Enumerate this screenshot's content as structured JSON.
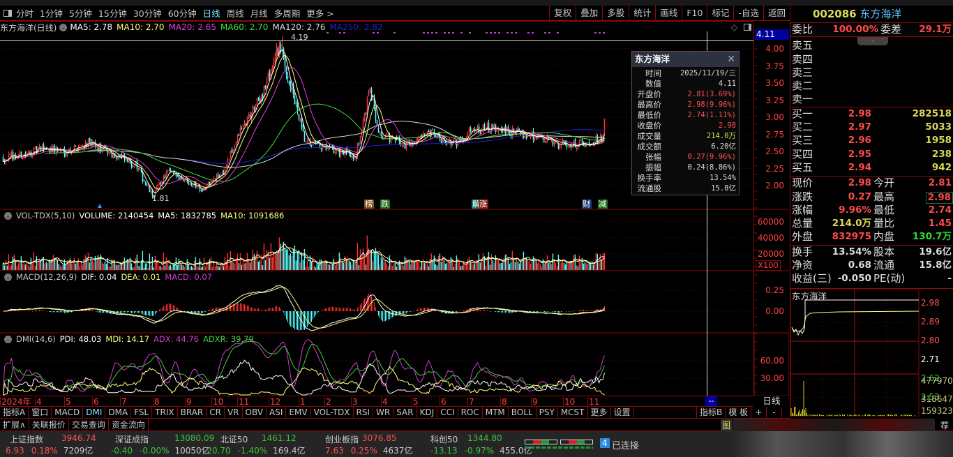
{
  "toolbar": {
    "periods": [
      "分时",
      "1分钟",
      "5分钟",
      "15分钟",
      "30分钟",
      "60分钟",
      "日线",
      "周线",
      "月线",
      "多周期",
      "更多 >"
    ],
    "active_period": "日线",
    "right": [
      "复权",
      "叠加",
      "多股",
      "统计",
      "画线",
      "F10",
      "标记",
      "-自选",
      "返回"
    ]
  },
  "title_row": {
    "name": "东方海洋(日线)",
    "mas": [
      {
        "label": "MA5: 2.78",
        "color": "#ffffff"
      },
      {
        "label": "MA10: 2.70",
        "color": "#ffff80"
      },
      {
        "label": "MA20: 2.65",
        "color": "#e040e0"
      },
      {
        "label": "MA60: 2.70",
        "color": "#40e040"
      },
      {
        "label": "MA120: 2.76",
        "color": "#dddddd"
      },
      {
        "label": "MA250: 2.82",
        "color": "#2020d0"
      }
    ]
  },
  "main": {
    "price_axis": [
      "4.00",
      "3.75",
      "3.50",
      "3.25",
      "3.00",
      "2.75",
      "2.50",
      "2.25",
      "2.00"
    ],
    "cursor_value": "4.11",
    "high_label": "4.19",
    "low_label": "1.81",
    "events": [
      {
        "t": "榜",
        "bg": "#7a4a20"
      },
      {
        "t": "跌",
        "bg": "#1f6a1f"
      },
      {
        "t": "解",
        "bg": "#1a7a7a"
      },
      {
        "t": "涨",
        "bg": "#8a1a1a"
      },
      {
        "t": "财",
        "bg": "#1a3a7a"
      },
      {
        "t": "减",
        "bg": "#1f6a1f"
      }
    ]
  },
  "tooltip": {
    "title": "东方海洋",
    "rows": [
      {
        "k": "时间",
        "v": "2025/11/19/三",
        "c": "#dddddd"
      },
      {
        "k": "数值",
        "v": "4.11",
        "c": "#dddddd"
      },
      {
        "k": "开盘价",
        "v": "2.81(3.69%)",
        "c": "#ff5050"
      },
      {
        "k": "最高价",
        "v": "2.98(9.96%)",
        "c": "#ff5050"
      },
      {
        "k": "最低价",
        "v": "2.74(1.11%)",
        "c": "#ff5050"
      },
      {
        "k": "收盘价",
        "v": "2.98",
        "c": "#ff5050"
      },
      {
        "k": "成交量",
        "v": "214.0万",
        "c": "#dada5a"
      },
      {
        "k": "成交额",
        "v": "6.20亿",
        "c": "#dddddd"
      },
      {
        "k": "张幅",
        "v": "0.27(9.96%)",
        "c": "#ff5050"
      },
      {
        "k": "振幅",
        "v": "0.24(8.86%)",
        "c": "#dddddd"
      },
      {
        "k": "换手率",
        "v": "13.54%",
        "c": "#dddddd"
      },
      {
        "k": "流通股",
        "v": "15.8亿",
        "c": "#dddddd"
      }
    ]
  },
  "vol": {
    "name": "VOL-TDX(5,10)",
    "volume": "VOLUME: 2140454",
    "ma5": "MA5: 1832785",
    "ma10": "MA10: 1091686",
    "axis": [
      "60000",
      "40000",
      "20000"
    ],
    "unit": "X100"
  },
  "macd": {
    "name": "MACD(12,26,9)",
    "dif": "DIF: 0.04",
    "dea": "DEA: 0.01",
    "macd": "MACD: 0.07",
    "axis": [
      "0.25",
      "0.00"
    ]
  },
  "dmi": {
    "name": "DMI(14,6)",
    "pdi": "PDI: 48.03",
    "mdi": "MDI: 14.17",
    "adx": "ADX: 44.76",
    "adxr": "ADXR: 39.79",
    "axis": [
      "60.00",
      "30.00"
    ]
  },
  "date_axis": {
    "labels": [
      "2024年",
      "4",
      "5",
      "6",
      "7",
      "8",
      "9",
      "10",
      "11",
      "12",
      "1",
      "2",
      "3",
      "4",
      "5",
      "6",
      "7",
      "8",
      "9",
      "10",
      "11"
    ],
    "cursor": "--",
    "period": "日线"
  },
  "indicator_tabs": [
    "指标A",
    "窗口",
    "MACD",
    "DMI",
    "DMA",
    "FSL",
    "TRIX",
    "BRAR",
    "CR",
    "VR",
    "OBV",
    "ASI",
    "EMV",
    "VOL-TDX",
    "RSI",
    "WR",
    "SAR",
    "KDJ",
    "CCI",
    "ROC",
    "MTM",
    "BOLL",
    "PSY",
    "MCST",
    "更多",
    "设置"
  ],
  "active_tab": "DMI",
  "right_tabs": [
    "指标B",
    "模 板",
    "+",
    "-"
  ],
  "ext_tabs": [
    "扩展∧",
    "关联报价",
    "交易查询",
    "资金流向"
  ],
  "ext_right": [
    "图",
    "荐"
  ],
  "quote": {
    "code": "002086",
    "name": "东方海洋",
    "weibi": {
      "l": "委比",
      "v": "100.00%",
      "l2": "委差",
      "v2": "29.1万"
    },
    "sell": [
      "卖五",
      "卖四",
      "卖三",
      "卖二",
      "卖一"
    ],
    "buy": [
      {
        "l": "买一",
        "p": "2.98",
        "v": "282518"
      },
      {
        "l": "买二",
        "p": "2.97",
        "v": "5033"
      },
      {
        "l": "买三",
        "p": "2.96",
        "v": "1958"
      },
      {
        "l": "买四",
        "p": "2.95",
        "v": "238"
      },
      {
        "l": "买五",
        "p": "2.94",
        "v": "942"
      }
    ],
    "stats": [
      {
        "l": "现价",
        "v": "2.98",
        "vc": "red",
        "l2": "今开",
        "v2": "2.81",
        "v2c": "red"
      },
      {
        "l": "涨跌",
        "v": "0.27",
        "vc": "red",
        "l2": "最高",
        "v2": "2.98",
        "v2c": "red"
      },
      {
        "l": "涨幅",
        "v": "9.96%",
        "vc": "red",
        "l2": "最低",
        "v2": "2.74",
        "v2c": "red"
      },
      {
        "l": "总量",
        "v": "214.0万",
        "vc": "yel",
        "l2": "量比",
        "v2": "1.45",
        "v2c": "red"
      },
      {
        "l": "外盘",
        "v": "832975",
        "vc": "red",
        "l2": "内盘",
        "v2": "130.7万",
        "v2c": "grn"
      }
    ],
    "fund": [
      {
        "l": "换手",
        "v": "13.54%",
        "l2": "股本",
        "v2": "19.6亿"
      },
      {
        "l": "净资",
        "v": "0.68",
        "l2": "流通",
        "v2": "15.8亿"
      },
      {
        "l": "收益(三)",
        "v": "-0.050",
        "l2": "PE(动)",
        "v2": "-"
      }
    ]
  },
  "mini": {
    "title": "东方海洋",
    "price_axis": [
      {
        "v": "2.98",
        "c": "#ff5050"
      },
      {
        "v": "2.89",
        "c": "#ff5050"
      },
      {
        "v": "2.80",
        "c": "#ff5050"
      },
      {
        "v": "2.71",
        "c": "#ffffff"
      },
      {
        "v": "2.62",
        "c": "#40c040"
      },
      {
        "v": "2.53",
        "c": "#40c040"
      }
    ],
    "vol_axis": [
      "477970",
      "318647",
      "159323"
    ]
  },
  "status": {
    "indices": [
      {
        "name": "上证指数",
        "value": "3946.74",
        "chg": "6.93",
        "pct": "0.18%",
        "amt": "7209亿",
        "c": "#ff5050"
      },
      {
        "name": "深证成指",
        "value": "13080.09",
        "chg": "-0.40",
        "pct": "-0.00%",
        "amt": "10050亿",
        "c": "#40c040"
      },
      {
        "name": "北证50",
        "value": "1461.12",
        "chg": "-20.70",
        "pct": "-1.40%",
        "amt": "169.4亿",
        "c": "#40c040"
      },
      {
        "name": "创业板指",
        "value": "3076.85",
        "chg": "7.63",
        "pct": "0.25%",
        "amt": "4637亿",
        "c": "#ff5050"
      },
      {
        "name": "科创50",
        "value": "1344.80",
        "chg": "-13.13",
        "pct": "-0.97%",
        "amt": "455.0亿",
        "c": "#40c040"
      }
    ],
    "conn_num": "4",
    "conn": "已连接"
  },
  "chart_data": {
    "type": "candlestick",
    "days": 432,
    "close_anchors": [
      [
        0,
        2.4
      ],
      [
        15,
        2.45
      ],
      [
        30,
        2.55
      ],
      [
        45,
        2.5
      ],
      [
        60,
        2.62
      ],
      [
        75,
        2.5
      ],
      [
        95,
        2.3
      ],
      [
        107,
        1.85
      ],
      [
        118,
        2.2
      ],
      [
        130,
        2.1
      ],
      [
        143,
        1.95
      ],
      [
        158,
        2.2
      ],
      [
        170,
        2.8
      ],
      [
        185,
        3.3
      ],
      [
        198,
        4.05
      ],
      [
        208,
        3.3
      ],
      [
        216,
        2.65
      ],
      [
        228,
        2.55
      ],
      [
        253,
        2.45
      ],
      [
        263,
        3.4
      ],
      [
        270,
        2.75
      ],
      [
        288,
        2.6
      ],
      [
        308,
        2.75
      ],
      [
        323,
        2.6
      ],
      [
        338,
        2.85
      ],
      [
        358,
        2.8
      ],
      [
        378,
        2.75
      ],
      [
        398,
        2.6
      ],
      [
        418,
        2.62
      ],
      [
        430,
        2.72
      ],
      [
        431,
        2.98
      ]
    ],
    "last_candle": {
      "open": 2.81,
      "high": 2.98,
      "low": 2.74,
      "close": 2.98
    }
  }
}
